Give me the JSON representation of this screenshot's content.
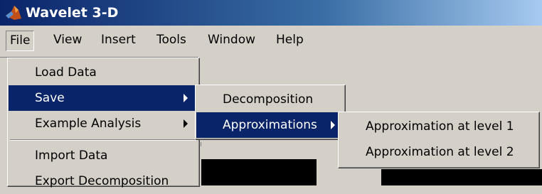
{
  "window": {
    "title": "Wavelet 3-D",
    "logo_icon": "matlab-logo-icon"
  },
  "menubar": {
    "items": [
      "File",
      "View",
      "Insert",
      "Tools",
      "Window",
      "Help"
    ],
    "active": "File"
  },
  "file_menu": {
    "items": [
      {
        "label": "Load Data",
        "submenu": false
      },
      {
        "label": "Save",
        "submenu": true,
        "selected": true
      },
      {
        "label": "Example Analysis",
        "submenu": true
      },
      {
        "label": "Import Data",
        "submenu": false
      },
      {
        "label": "Export Decomposition",
        "submenu": false
      }
    ]
  },
  "save_menu": {
    "items": [
      {
        "label": "Decomposition",
        "submenu": false
      },
      {
        "label": "Approximations",
        "submenu": true,
        "selected": true
      }
    ]
  },
  "approx_menu": {
    "items": [
      {
        "label": "Approximation at level 1"
      },
      {
        "label": "Approximation at level 2"
      }
    ]
  },
  "colors": {
    "selection": "#0a246a",
    "face": "#d4d0c8",
    "axes": "#000000"
  }
}
